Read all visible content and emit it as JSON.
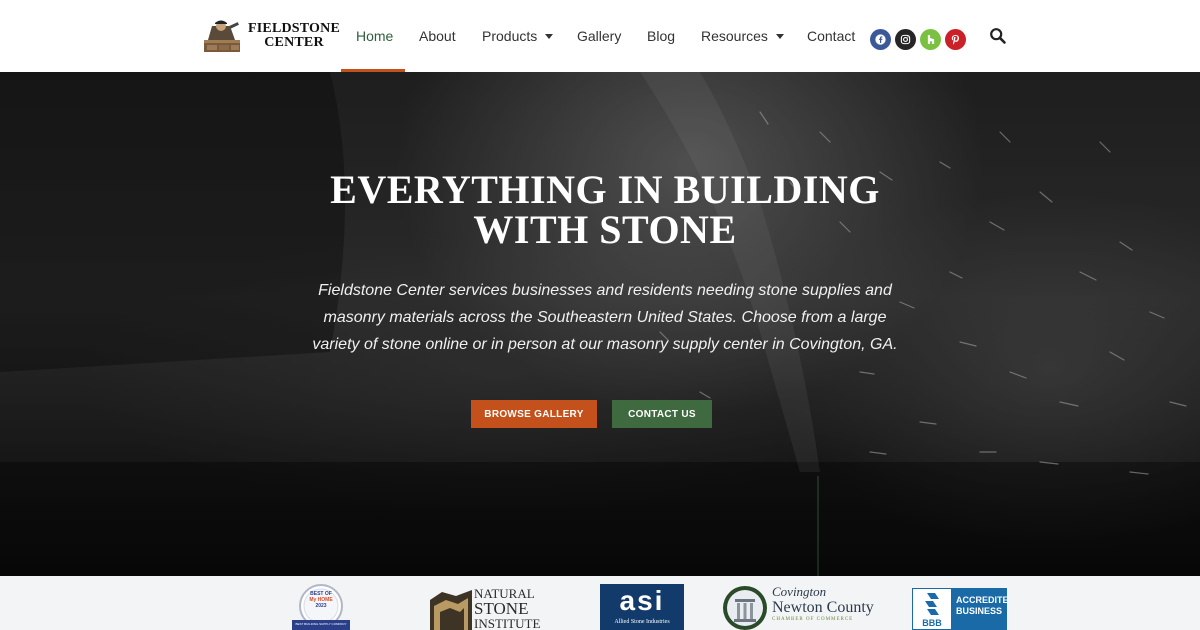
{
  "brand": {
    "name_line1": "FIELDSTONE",
    "name_line2": "CENTER"
  },
  "nav": {
    "items": [
      {
        "label": "Home",
        "active": true
      },
      {
        "label": "About"
      },
      {
        "label": "Products",
        "dropdown": true
      },
      {
        "label": "Gallery"
      },
      {
        "label": "Blog"
      },
      {
        "label": "Resources",
        "dropdown": true
      },
      {
        "label": "Contact"
      }
    ],
    "social": [
      {
        "icon": "facebook-icon",
        "color": "#3b5998"
      },
      {
        "icon": "instagram-icon",
        "color": "#262626"
      },
      {
        "icon": "houzz-icon",
        "color": "#7ac142"
      },
      {
        "icon": "pinterest-icon",
        "color": "#cb2027"
      }
    ],
    "search_icon": "search-icon"
  },
  "hero": {
    "title_line1": "EVERYTHING IN BUILDING",
    "title_line2": "WITH STONE",
    "subtitle_line1": "Fieldstone Center services businesses and residents needing stone supplies and",
    "subtitle_line2": "masonry materials across the Southeastern United States. Choose from a large",
    "subtitle_line3": "variety of stone online or in person at our masonry supply center in Covington, GA.",
    "browse_label": "BROWSE GALLERY",
    "contact_label": "CONTACT US"
  },
  "partners": {
    "best_of": {
      "line1": "BEST OF",
      "line2": "My HOME",
      "year": "2023",
      "caption": "BEST BUILDING SUPPLY COMPANY"
    },
    "nsi": {
      "line1": "NATURAL",
      "line2": "STONE",
      "line3": "INSTITUTE"
    },
    "asi": {
      "mark": "asi",
      "caption": "Allied Stone Industries"
    },
    "newton": {
      "script": "Covington",
      "line": "Newton County",
      "caption": "CHAMBER OF COMMERCE"
    },
    "bbb": {
      "mark": "BBB",
      "line1": "ACCREDITED",
      "line2": "BUSINESS"
    }
  },
  "colors": {
    "accent": "#c4501b",
    "green": "#3f6a3f",
    "nav_active": "#2f5e3b"
  }
}
